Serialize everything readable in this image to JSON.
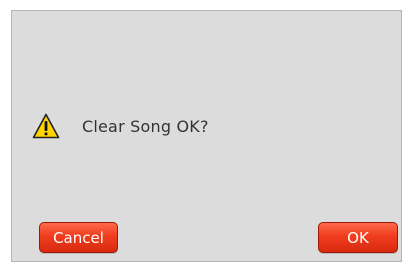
{
  "dialog": {
    "message": "Clear Song OK?",
    "icon": "warning-triangle-icon",
    "cancel_label": "Cancel",
    "ok_label": "OK"
  },
  "colors": {
    "background": "#dcdcdc",
    "button": "#ef3d1e",
    "icon_fill": "#ffd400"
  }
}
